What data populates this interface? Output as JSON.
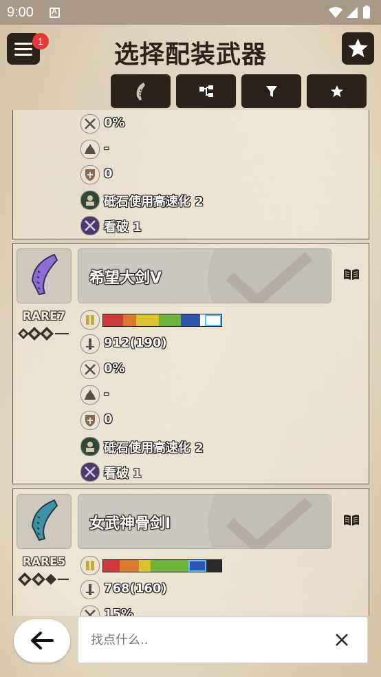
{
  "status_bar": {
    "time": "9:00"
  },
  "header": {
    "title": "选择配装武器",
    "badge_count": "1",
    "icons": [
      "menu-icon",
      "star-icon"
    ]
  },
  "toolbar": {
    "buttons": [
      "weapon-type-icon",
      "tree-icon",
      "filter-icon",
      "star-icon"
    ]
  },
  "partial_card": {
    "stats": [
      {
        "icon": "affinity-icon",
        "value": "0%"
      },
      {
        "icon": "element-icon",
        "value": "-"
      },
      {
        "icon": "defense-icon",
        "value": "0"
      },
      {
        "icon": "skill-icon",
        "value": "砥石使用高速化 2"
      },
      {
        "icon": "skill-icon",
        "value": "看破 1"
      }
    ]
  },
  "weapons": [
    {
      "name": "希望大剑Ⅴ",
      "rarity": "RARE7",
      "weapon_color": "#8f6bd6",
      "sharpness": [
        {
          "color": "#cf3b3b",
          "pct": 17
        },
        {
          "color": "#d97a2e",
          "pct": 11
        },
        {
          "color": "#d9c22b",
          "pct": 19
        },
        {
          "color": "#6fb33d",
          "pct": 19
        },
        {
          "color": "#2f55b0",
          "pct": 16
        },
        {
          "color": "#ffffff",
          "pct": 4
        },
        {
          "color": "#ffffff",
          "pct": 14,
          "highlight": true
        }
      ],
      "stats": [
        {
          "icon": "attack-icon",
          "value": "912(190)"
        },
        {
          "icon": "affinity-icon",
          "value": "0%"
        },
        {
          "icon": "element-icon",
          "value": "-"
        },
        {
          "icon": "defense-icon",
          "value": "0"
        },
        {
          "icon": "skill-icon",
          "value": "砥石使用高速化 2"
        },
        {
          "icon": "skill-icon",
          "value": "看破 1"
        }
      ]
    },
    {
      "name": "女武神骨剑Ⅰ",
      "rarity": "RARE5",
      "weapon_color": "#3f93a8",
      "sharpness": [
        {
          "color": "#cf3b3b",
          "pct": 14
        },
        {
          "color": "#d97a2e",
          "pct": 16
        },
        {
          "color": "#d9c22b",
          "pct": 10
        },
        {
          "color": "#6fb33d",
          "pct": 32
        },
        {
          "color": "#2f55b0",
          "pct": 15,
          "highlight": true
        }
      ],
      "stats": [
        {
          "icon": "attack-icon",
          "value": "768(160)"
        },
        {
          "icon": "affinity-icon",
          "value": "15%"
        }
      ]
    }
  ],
  "search": {
    "placeholder": "找点什么.."
  }
}
